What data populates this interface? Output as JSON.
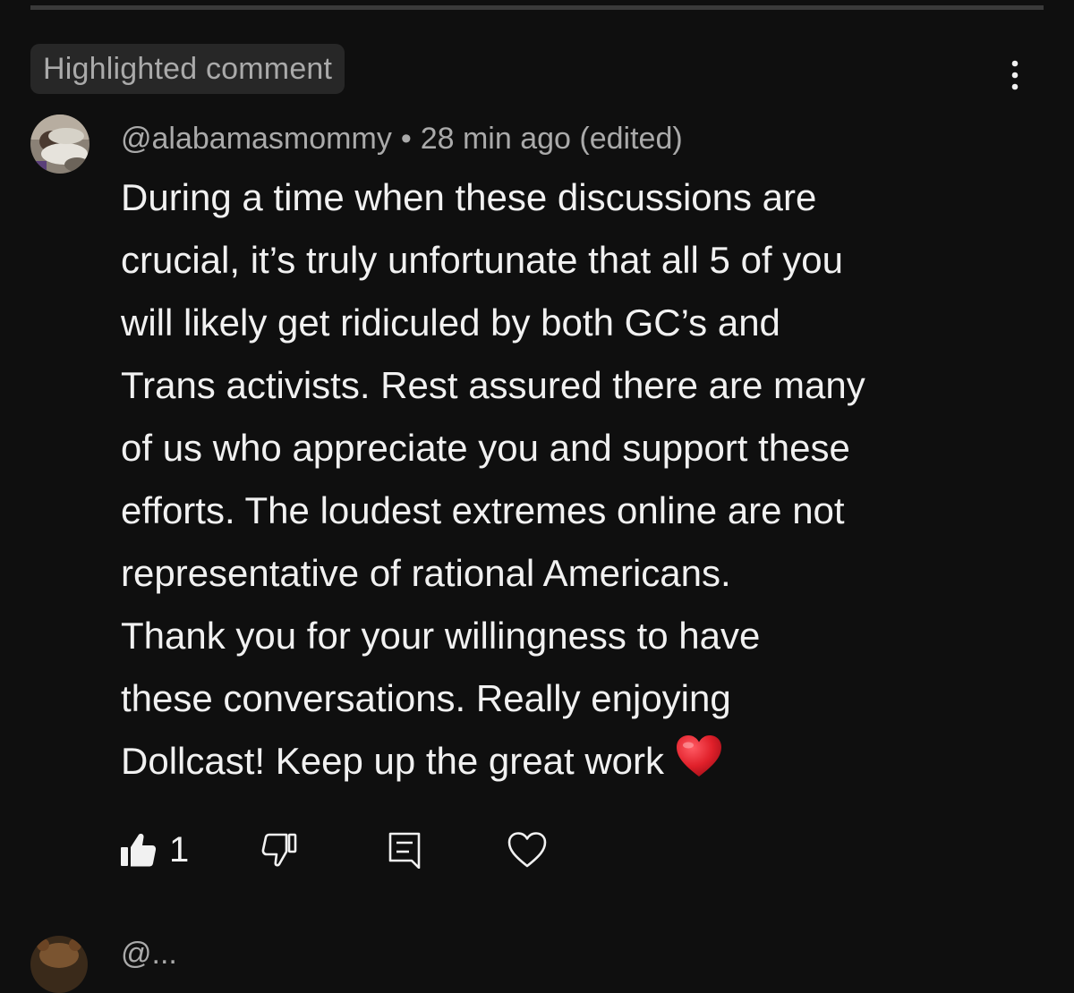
{
  "comment": {
    "badge": "Highlighted comment",
    "author": "@alabamasmommy",
    "separator": "•",
    "timestamp": "28 min ago",
    "edited": "(edited)",
    "text": "During a time when these discussions are\ncrucial, it’s truly unfortunate that all 5 of you\nwill likely get ridiculed by both GC’s and\nTrans activists. Rest assured there are many\nof us who appreciate you and support these\nefforts. The loudest extremes online are not\nrepresentative of rational Americans.\nThank you for your willingness to have\nthese conversations. Really enjoying\nDollcast! Keep up the great work",
    "emoji": "❤️",
    "likes": "1",
    "icons": {
      "more": "more-vertical-icon",
      "like": "thumbs-up-filled-icon",
      "dislike": "thumbs-down-icon",
      "reply": "reply-icon",
      "heart": "heart-outline-icon"
    }
  },
  "next_comment": {
    "author_partial": "@..."
  },
  "colors": {
    "background": "#0f0f0f",
    "badge_bg": "#272727",
    "secondary_text": "#aaaaaa",
    "primary_text": "#f1f1f1",
    "emoji_red": "#e0202a"
  }
}
